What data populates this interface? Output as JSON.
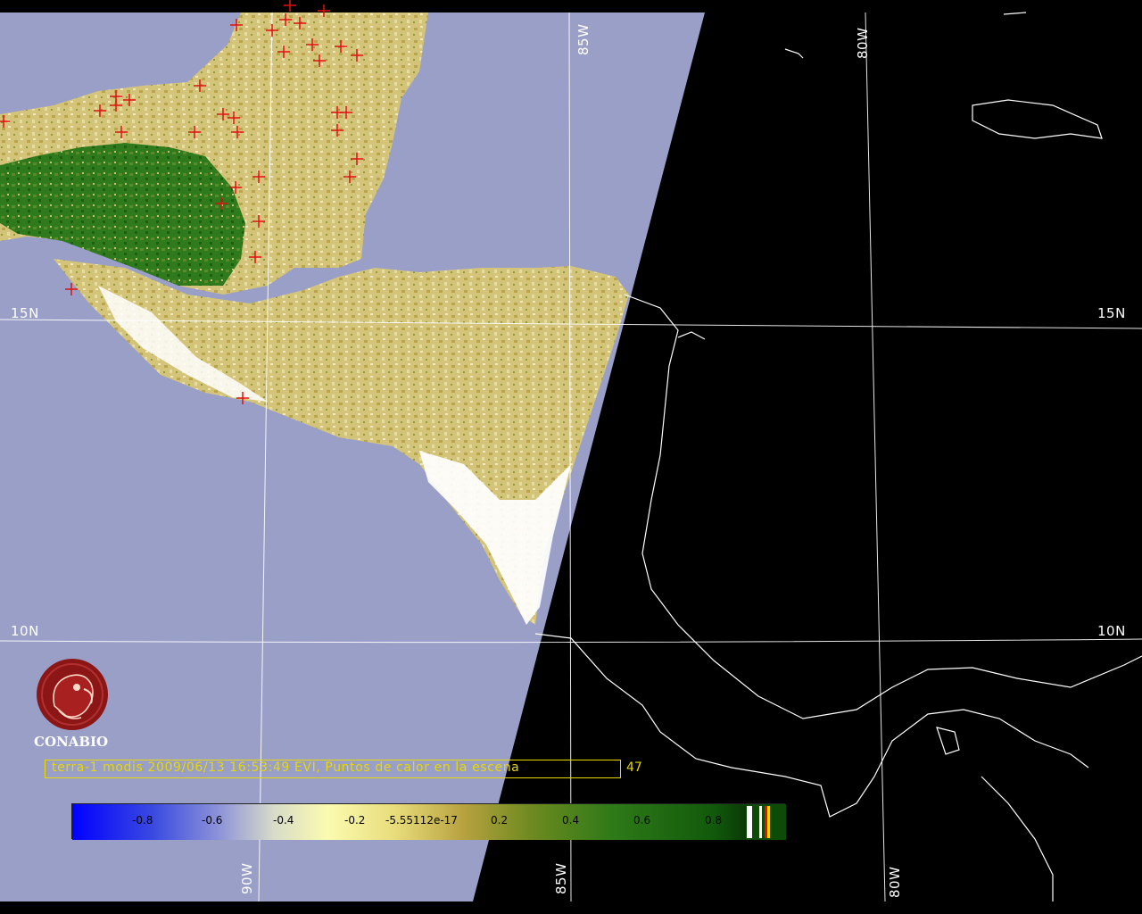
{
  "grid_labels": {
    "lat_15n_left": "15N",
    "lat_15n_right": "15N",
    "lat_10n_left": "10N",
    "lat_10n_right": "10N",
    "lon_85w_top": "85W",
    "lon_80w_top": "80W",
    "lon_90w_bottom": "90W",
    "lon_85w_bottom": "85W",
    "lon_80w_bottom": "80W"
  },
  "logo": {
    "text": "CONABIO",
    "icon": "conabio-macaw-emblem"
  },
  "caption": {
    "text": "terra-1 modis 2009/06/13 16:53:49 EVI, Puntos de calor en la escena",
    "count": "47"
  },
  "colorbar": {
    "labels": [
      "-0.8",
      "-0.6",
      "-0.4",
      "-0.2",
      "-5.55112e-17",
      "0.2",
      "0.4",
      "0.6",
      "0.8"
    ]
  },
  "colors": {
    "water": "#9a9fc8",
    "night": "#000000",
    "grid": "#ffffff",
    "hotspot": "#e01010",
    "caption": "#e6d800",
    "land_yellow": "#cfc27a",
    "land_green": "#2f7a1c"
  }
}
